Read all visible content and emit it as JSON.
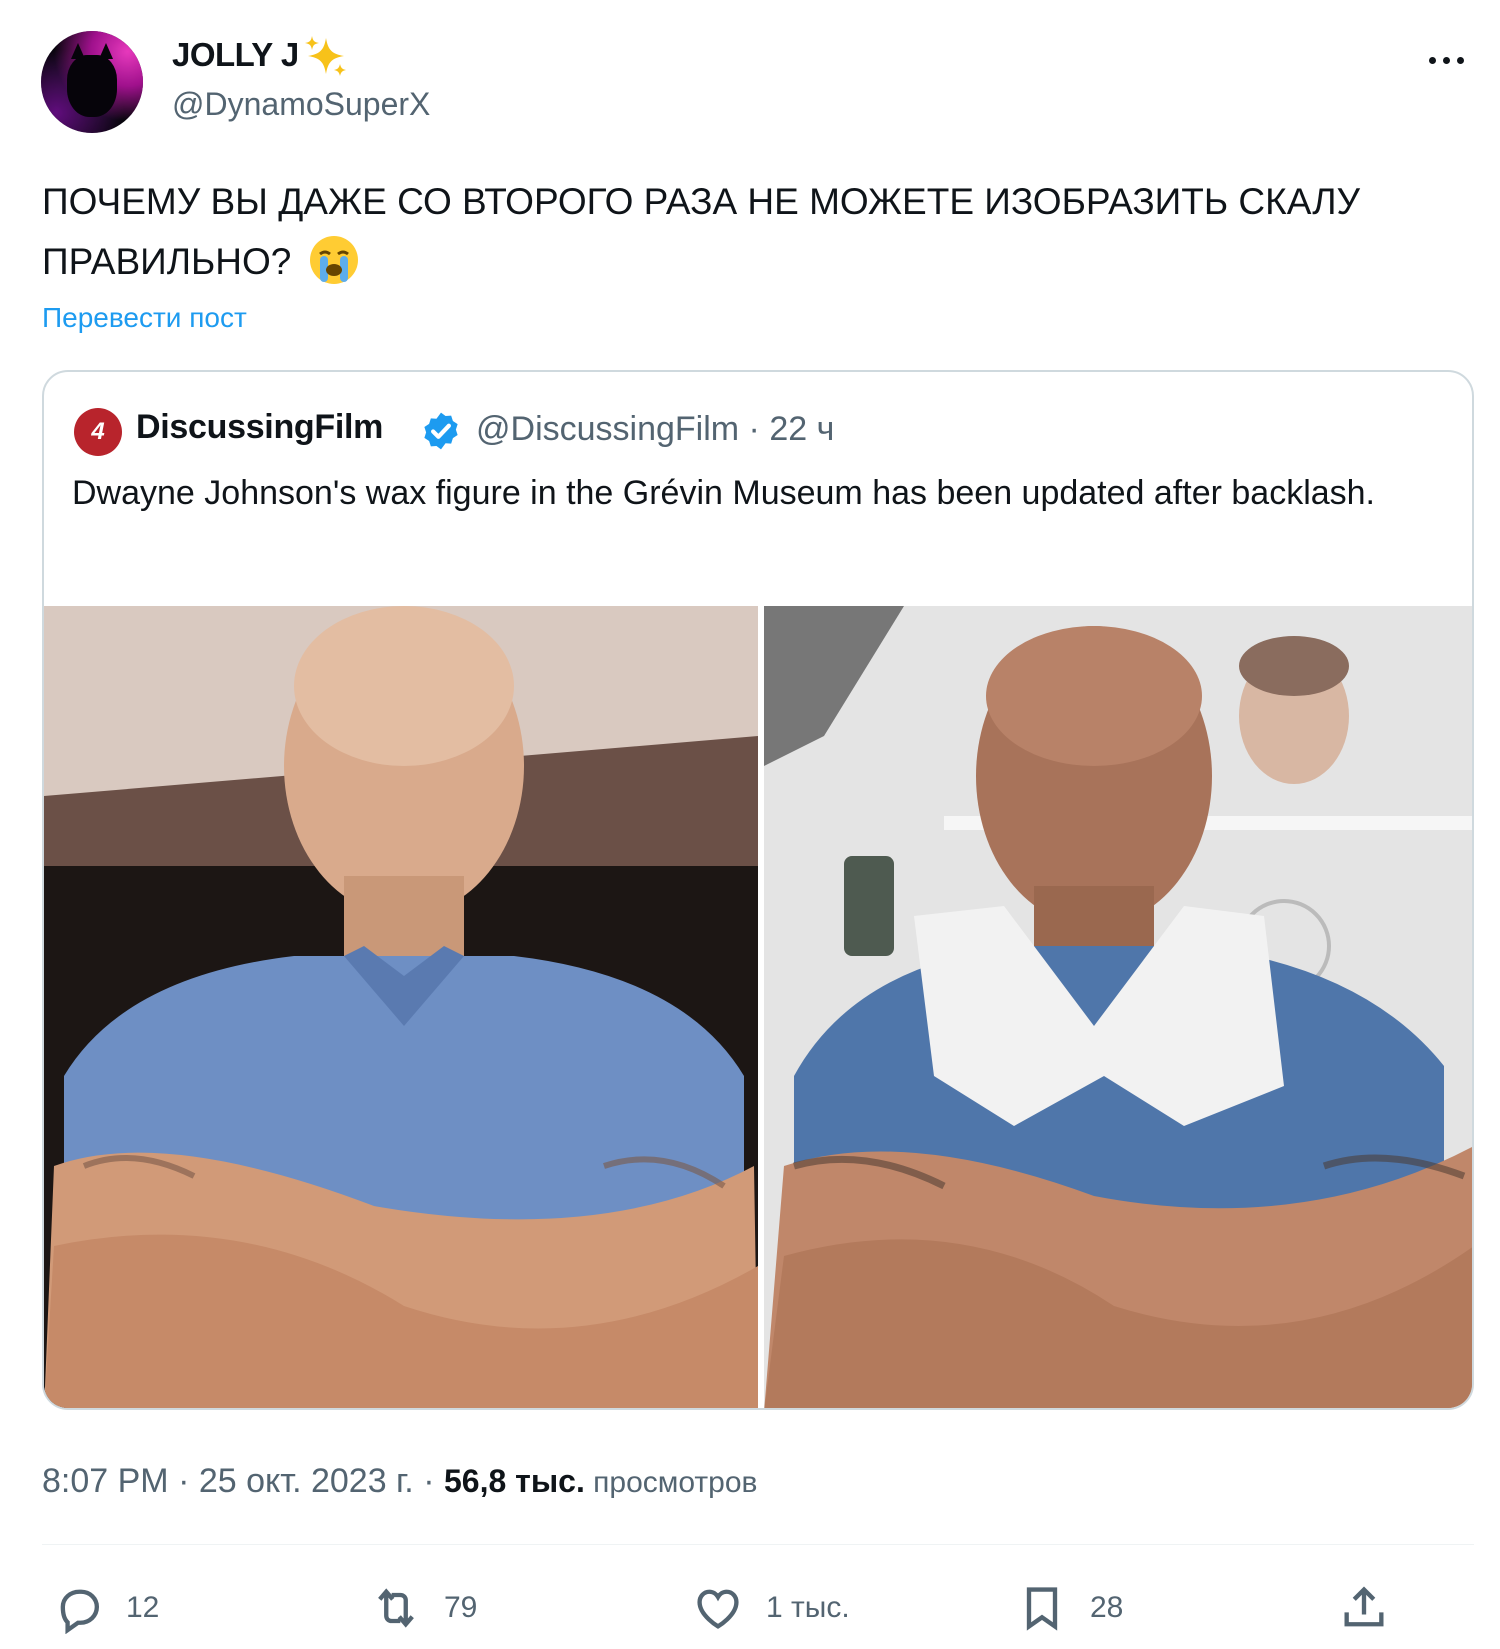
{
  "author": {
    "display_name": "JOLLY J",
    "handle": "@DynamoSuperX",
    "avatar_icon": "batman-avatar-icon"
  },
  "tweet": {
    "text": "ПОЧЕМУ ВЫ ДАЖЕ СО ВТОРОГО РАЗА НЕ МОЖЕТЕ ИЗОБРАЗИТЬ СКАЛУ ПРАВИЛЬНО?",
    "emoji_icon": "crying-face-icon",
    "translate_label": "Перевести пост"
  },
  "quoted": {
    "name": "DiscussingFilm",
    "logo_text": "4",
    "logo_color": "#b8242c",
    "verified_color": "#1d9bf0",
    "handle_time": "@DiscussingFilm · 22 ч",
    "text": "Dwayne Johnson's wax figure in the Grévin Museum has been updated after backlash."
  },
  "meta": {
    "time_date": "8:07 PM · 25 окт. 2023 г. · ",
    "views_count": "56,8 тыс.",
    "views_label": " просмотров"
  },
  "actions": {
    "replies": "12",
    "reposts": "79",
    "likes": "1 тыс.",
    "bookmarks": "28"
  },
  "colors": {
    "text": "#0f1419",
    "secondary": "#536471",
    "link": "#1d9bf0",
    "border": "#cfd9de"
  }
}
